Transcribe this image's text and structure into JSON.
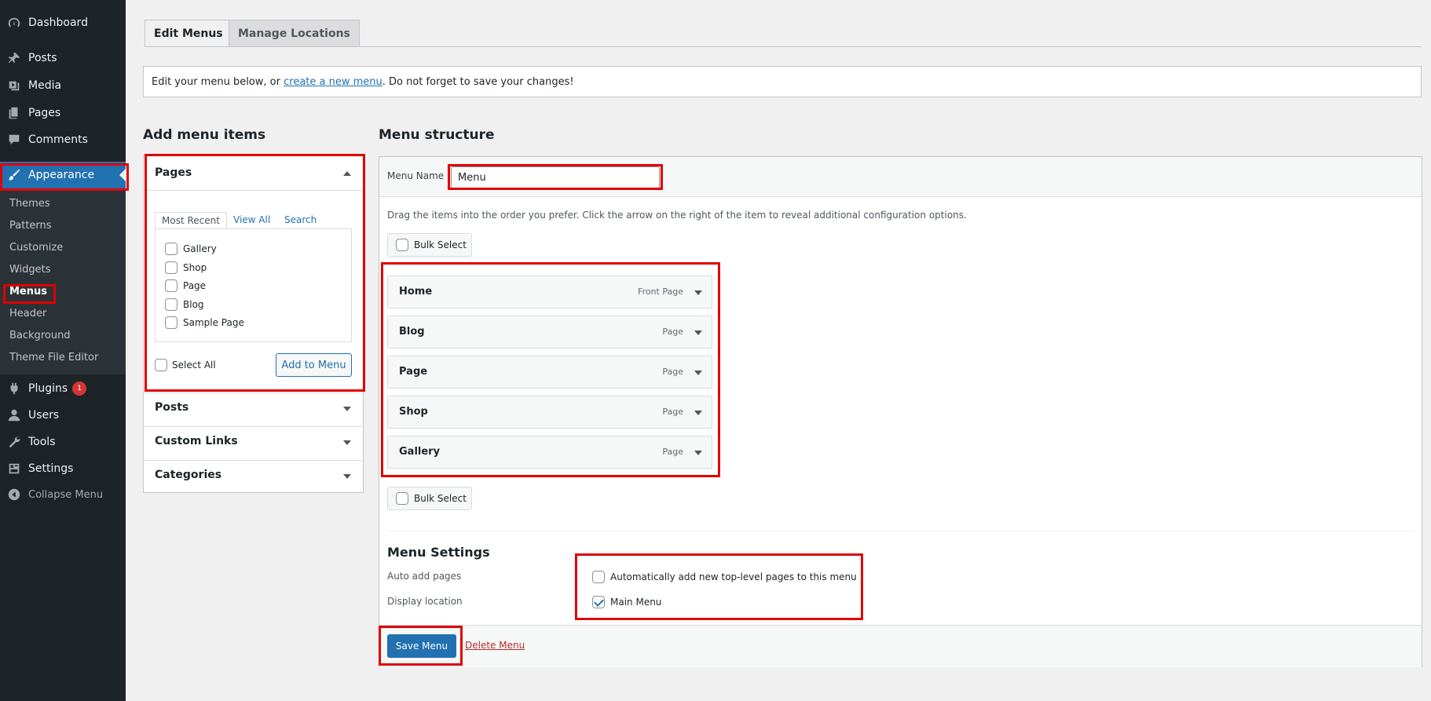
{
  "sidebar": {
    "items": [
      {
        "label": "Dashboard",
        "icon": "dashboard-icon"
      },
      {
        "label": "Posts",
        "icon": "pushpin-icon"
      },
      {
        "label": "Media",
        "icon": "media-icon"
      },
      {
        "label": "Pages",
        "icon": "pages-icon"
      },
      {
        "label": "Comments",
        "icon": "comment-icon"
      },
      {
        "label": "Appearance",
        "icon": "paintbrush-icon"
      },
      {
        "label": "Plugins",
        "icon": "plugin-icon",
        "badge": "1"
      },
      {
        "label": "Users",
        "icon": "user-icon"
      },
      {
        "label": "Tools",
        "icon": "wrench-icon"
      },
      {
        "label": "Settings",
        "icon": "settings-icon"
      },
      {
        "label": "Collapse Menu",
        "icon": "collapse-icon"
      }
    ],
    "submenu": [
      "Themes",
      "Patterns",
      "Customize",
      "Widgets",
      "Menus",
      "Header",
      "Background",
      "Theme File Editor"
    ]
  },
  "tabs": {
    "edit": "Edit Menus",
    "manage": "Manage Locations"
  },
  "notice": {
    "before": "Edit your menu below, or ",
    "link": "create a new menu",
    "after": ". Do not forget to save your changes!"
  },
  "add_items": {
    "heading": "Add menu items",
    "pages": {
      "title": "Pages",
      "tabs": [
        "Most Recent",
        "View All",
        "Search"
      ],
      "list": [
        "Gallery",
        "Shop",
        "Page",
        "Blog",
        "Sample Page"
      ],
      "select_all": "Select All",
      "add_button": "Add to Menu"
    },
    "sections": [
      "Posts",
      "Custom Links",
      "Categories"
    ]
  },
  "structure": {
    "heading": "Menu structure",
    "menu_name_label": "Menu Name",
    "menu_name_value": "Menu",
    "instructions": "Drag the items into the order you prefer. Click the arrow on the right of the item to reveal additional configuration options.",
    "bulk_select": "Bulk Select",
    "items": [
      {
        "title": "Home",
        "type": "Front Page"
      },
      {
        "title": "Blog",
        "type": "Page"
      },
      {
        "title": "Page",
        "type": "Page"
      },
      {
        "title": "Shop",
        "type": "Page"
      },
      {
        "title": "Gallery",
        "type": "Page"
      }
    ],
    "settings": {
      "heading": "Menu Settings",
      "auto_add_label": "Auto add pages",
      "auto_add_text": "Automatically add new top-level pages to this menu",
      "auto_add_checked": false,
      "display_label": "Display location",
      "location_text": "Main Menu",
      "location_checked": true
    },
    "save_button": "Save Menu",
    "delete_link": "Delete Menu"
  },
  "colors": {
    "accent": "#2271b1",
    "sidebar_bg": "#1d2327",
    "highlight": "#e00000",
    "danger": "#d63638"
  }
}
